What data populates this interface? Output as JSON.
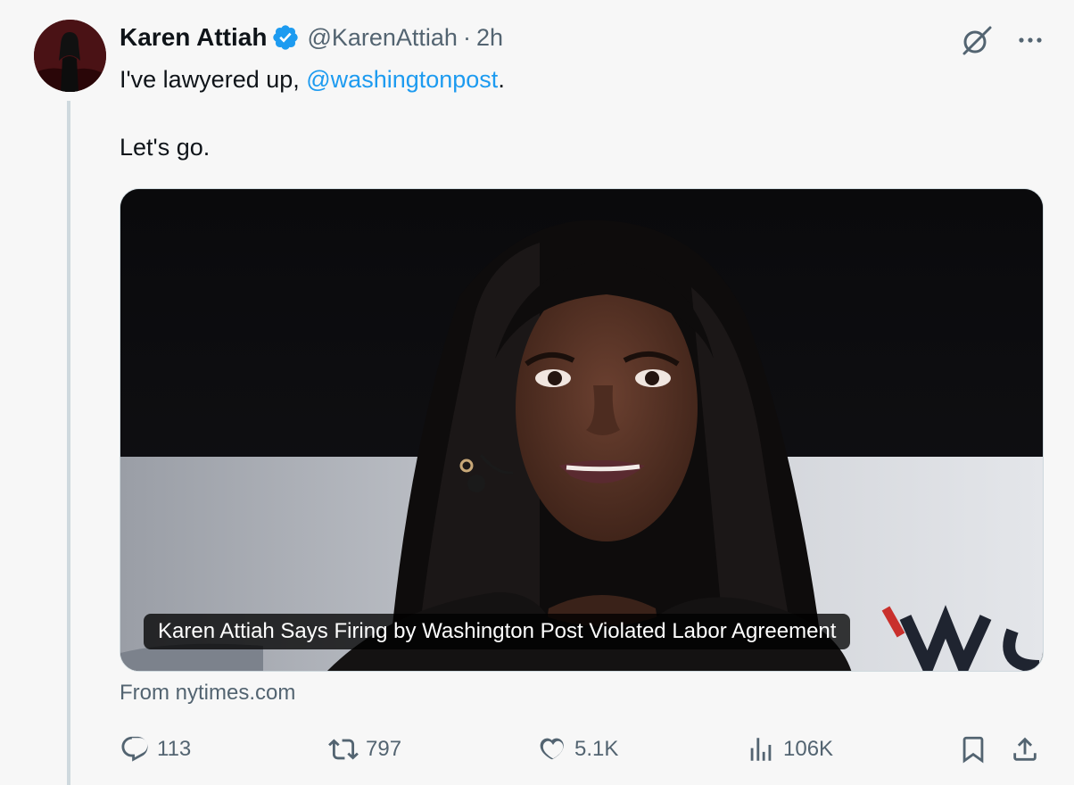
{
  "tweet": {
    "author": {
      "display_name": "Karen Attiah",
      "handle": "@KarenAttiah",
      "verified": true
    },
    "separator": "·",
    "time_ago": "2h",
    "text": {
      "line1_prefix": "I've lawyered up, ",
      "mention": "@washingtonpost",
      "line1_suffix": ".",
      "line2": "Let's go."
    },
    "card": {
      "title": "Karen Attiah Says Firing by Washington Post Violated Labor Agreement",
      "source": "From nytimes.com"
    },
    "actions": {
      "replies": "113",
      "retweets": "797",
      "likes": "5.1K",
      "views": "106K"
    }
  },
  "icons": {
    "verified": "verified-badge-icon",
    "grok": "grok-icon",
    "more": "more-options-icon",
    "reply": "reply-icon",
    "retweet": "retweet-icon",
    "like": "heart-icon",
    "views": "views-chart-icon",
    "bookmark": "bookmark-icon",
    "share": "share-icon"
  },
  "colors": {
    "accent": "#1d9bf0",
    "secondary_text": "#536471",
    "primary_text": "#0f1419",
    "background": "#f7f7f7"
  }
}
